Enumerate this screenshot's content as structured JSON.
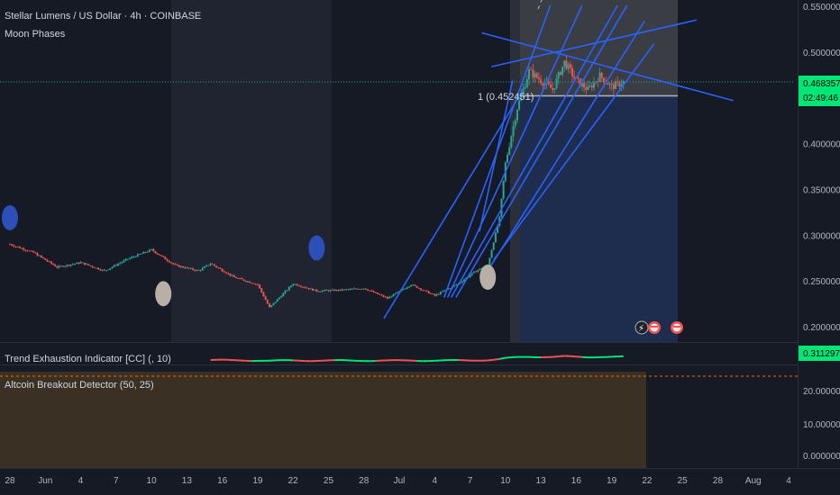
{
  "header": {
    "title": "Stellar Lumens / US Dollar · 4h · COINBASE",
    "indicator1": "Moon Phases"
  },
  "colors": {
    "background": "#161a25",
    "up": "#26a69a",
    "down": "#ef5350",
    "trendline": "#2962ff",
    "accent_green": "#00e676"
  },
  "chart_data": [
    {
      "type": "candlestick",
      "title": "Stellar Lumens / US Dollar · 4h · COINBASE",
      "x_ticks": [
        "28",
        "Jun",
        "4",
        "7",
        "10",
        "13",
        "16",
        "19",
        "22",
        "25",
        "28",
        "Jul",
        "4",
        "7",
        "10",
        "13",
        "16",
        "19",
        "22",
        "25",
        "28",
        "Aug",
        "4"
      ],
      "y_ticks": [
        "0.550000",
        "0.500000",
        "0.400000",
        "0.350000",
        "0.300000",
        "0.250000",
        "0.200000"
      ],
      "ylim": [
        0.187,
        0.555
      ],
      "price_path": [
        {
          "d": 0,
          "p": 0.291
        },
        {
          "d": 2,
          "p": 0.282
        },
        {
          "d": 4,
          "p": 0.266
        },
        {
          "d": 6,
          "p": 0.271
        },
        {
          "d": 8,
          "p": 0.262
        },
        {
          "d": 10,
          "p": 0.275
        },
        {
          "d": 12,
          "p": 0.285
        },
        {
          "d": 14,
          "p": 0.268
        },
        {
          "d": 16,
          "p": 0.262
        },
        {
          "d": 17,
          "p": 0.27
        },
        {
          "d": 19,
          "p": 0.255
        },
        {
          "d": 21,
          "p": 0.247
        },
        {
          "d": 22,
          "p": 0.222
        },
        {
          "d": 24,
          "p": 0.248
        },
        {
          "d": 26,
          "p": 0.24
        },
        {
          "d": 28,
          "p": 0.241
        },
        {
          "d": 30,
          "p": 0.243
        },
        {
          "d": 32,
          "p": 0.232
        },
        {
          "d": 34,
          "p": 0.247
        },
        {
          "d": 36,
          "p": 0.235
        },
        {
          "d": 38,
          "p": 0.248
        },
        {
          "d": 39.5,
          "p": 0.262
        },
        {
          "d": 40.5,
          "p": 0.268
        },
        {
          "d": 41.5,
          "p": 0.32
        },
        {
          "d": 42,
          "p": 0.38
        },
        {
          "d": 43,
          "p": 0.44
        },
        {
          "d": 44,
          "p": 0.48
        },
        {
          "d": 45,
          "p": 0.47
        },
        {
          "d": 46,
          "p": 0.46
        },
        {
          "d": 47,
          "p": 0.49
        },
        {
          "d": 48,
          "p": 0.47
        },
        {
          "d": 49,
          "p": 0.46
        },
        {
          "d": 50,
          "p": 0.475
        },
        {
          "d": 51,
          "p": 0.463
        },
        {
          "d": 52,
          "p": 0.468
        }
      ],
      "annotations": [
        {
          "label": "1 (0.452451)",
          "value": 0.452451
        },
        {
          "label": "0.468357",
          "value": 0.468357
        },
        {
          "label": "02:49:46"
        }
      ],
      "moon_phases": [
        {
          "d": 0,
          "p": 0.32,
          "phase": "new"
        },
        {
          "d": 26,
          "p": 0.287,
          "phase": "new"
        },
        {
          "d": 13,
          "p": 0.237,
          "phase": "full"
        },
        {
          "d": 40.5,
          "p": 0.255,
          "phase": "full"
        }
      ],
      "trendlines": [
        {
          "from": {
            "d": 31.7,
            "p": 0.21
          },
          "to": {
            "d": 43.5,
            "p": 0.46
          }
        },
        {
          "from": {
            "d": 36.8,
            "p": 0.233
          },
          "to": {
            "d": 45.8,
            "p": 0.552
          }
        },
        {
          "from": {
            "d": 37.1,
            "p": 0.233
          },
          "to": {
            "d": 48.5,
            "p": 0.552
          }
        },
        {
          "from": {
            "d": 37.4,
            "p": 0.233
          },
          "to": {
            "d": 51.5,
            "p": 0.552
          }
        },
        {
          "from": {
            "d": 37.8,
            "p": 0.233
          },
          "to": {
            "d": 52.3,
            "p": 0.552
          }
        },
        {
          "from": {
            "d": 40.5,
            "p": 0.262
          },
          "to": {
            "d": 53.8,
            "p": 0.535
          }
        },
        {
          "from": {
            "d": 41,
            "p": 0.274
          },
          "to": {
            "d": 54.6,
            "p": 0.51
          }
        },
        {
          "from": {
            "d": 39.8,
            "p": 0.305
          },
          "to": {
            "d": 42.6,
            "p": 0.47
          }
        },
        {
          "from": {
            "d": 40,
            "p": 0.522
          },
          "to": {
            "d": 61.3,
            "p": 0.448
          }
        },
        {
          "from": {
            "d": 40.8,
            "p": 0.485
          },
          "to": {
            "d": 58.2,
            "p": 0.536
          }
        }
      ],
      "event_markers": [
        "flag-icon",
        "flag-icon",
        "flag-icon"
      ]
    },
    {
      "type": "line",
      "title": "Trend Exhaustion Indicator [CC] (, 10)",
      "last_value": "0.311297"
    },
    {
      "type": "area",
      "title": "Altcoin Breakout Detector (50, 25)",
      "y_ticks": [
        "20.000000",
        "10.000000",
        "0.000000"
      ]
    }
  ]
}
